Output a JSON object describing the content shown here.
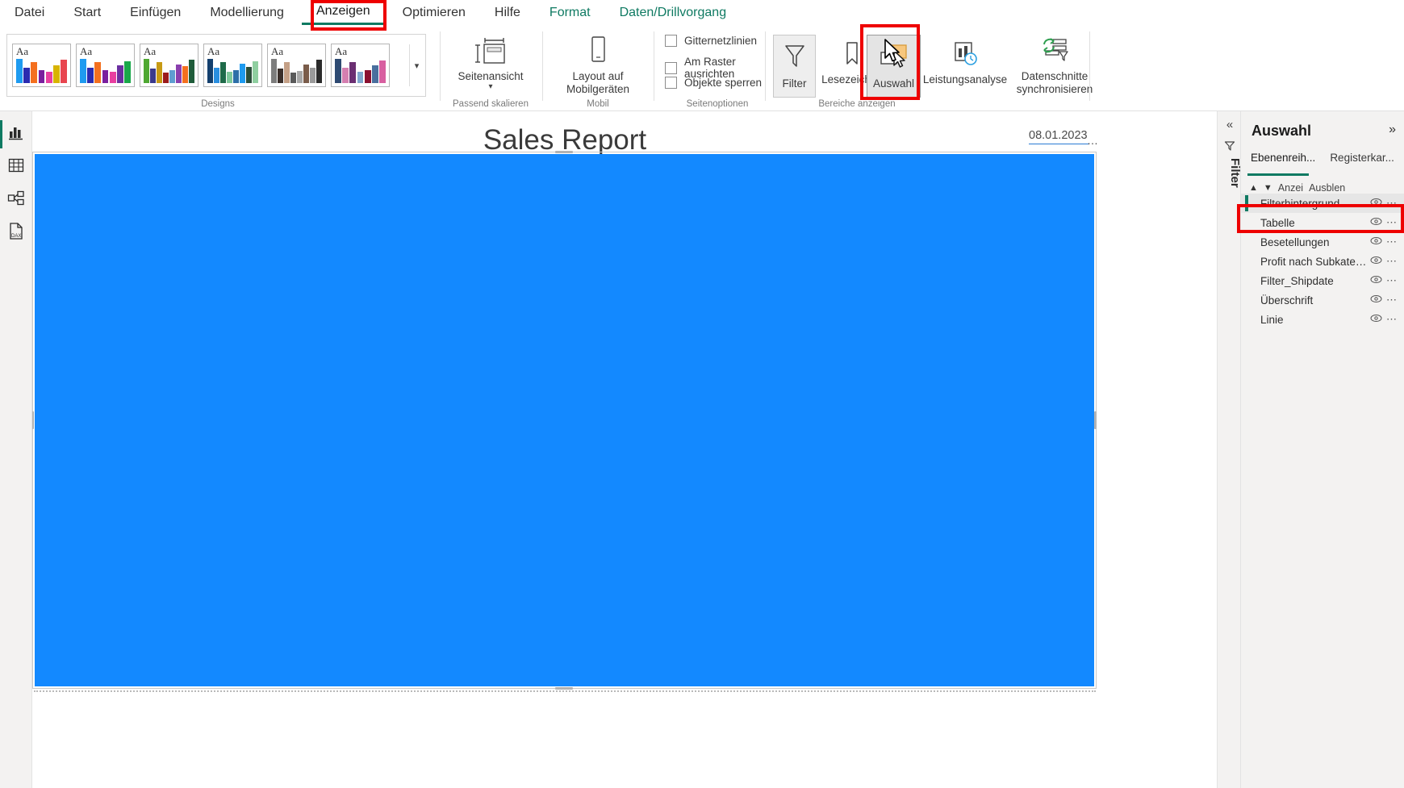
{
  "menu": {
    "items": [
      {
        "label": "Datei",
        "style": "normal"
      },
      {
        "label": "Start",
        "style": "normal"
      },
      {
        "label": "Einfügen",
        "style": "normal"
      },
      {
        "label": "Modellierung",
        "style": "normal"
      },
      {
        "label": "Anzeigen",
        "style": "active"
      },
      {
        "label": "Optimieren",
        "style": "normal"
      },
      {
        "label": "Hilfe",
        "style": "normal"
      },
      {
        "label": "Format",
        "style": "green"
      },
      {
        "label": "Daten/Drillvorgang",
        "style": "green"
      }
    ]
  },
  "ribbon": {
    "groups": {
      "designs_label": "Designs",
      "scale_label": "Passend skalieren",
      "mobile_label": "Mobil",
      "pageoptions_label": "Seitenoptionen",
      "panes_label": "Bereiche anzeigen"
    },
    "themes": [
      {
        "name": "theme-1",
        "colors": [
          "#1e9bf0",
          "#2b2bb0",
          "#f4701f",
          "#7a1f9e",
          "#e83fa0",
          "#d8b400",
          "#e8454f"
        ]
      },
      {
        "name": "theme-2",
        "colors": [
          "#1e9bf0",
          "#2b2bb0",
          "#f4701f",
          "#7a1f9e",
          "#e83fa0",
          "#6a2fa0",
          "#1aa84a"
        ]
      },
      {
        "name": "theme-3",
        "colors": [
          "#4fa832",
          "#3a3a8c",
          "#c79a14",
          "#9b1b1b",
          "#5f9ed1",
          "#8a3fae",
          "#f4701f",
          "#1f5c3a"
        ]
      },
      {
        "name": "theme-4",
        "colors": [
          "#14406e",
          "#2a8fe0",
          "#1f6b4a",
          "#7fc99b",
          "#2d6fa8",
          "#1e9bf0",
          "#2c4f3a",
          "#8fcfa0"
        ]
      },
      {
        "name": "theme-5",
        "colors": [
          "#7d7d7d",
          "#3a2e2a",
          "#c4a087",
          "#5a5a5a",
          "#a8a8a8",
          "#7a5c4a",
          "#9a9a9a",
          "#2b2b2b"
        ]
      },
      {
        "name": "theme-6",
        "colors": [
          "#2e4a72",
          "#d47fb0",
          "#6b2f72",
          "#7fa8cf",
          "#8a1030",
          "#4a6f9e",
          "#d85fa0"
        ]
      }
    ],
    "gallery_more_icon": "chevron-down-icon",
    "buttons": {
      "seitenansicht": {
        "label": "Seitenansicht",
        "icon": "page-view-icon",
        "has_caret": true
      },
      "mobile_layout": {
        "label": "Layout auf\nMobilgeräten",
        "line1": "Layout auf",
        "line2": "Mobilgeräten",
        "icon": "phone-icon"
      },
      "filter": {
        "label": "Filter",
        "icon": "funnel-icon"
      },
      "lesezeichen": {
        "label": "Lesezeichen",
        "icon": "bookmark-icon"
      },
      "auswahl": {
        "label": "Auswahl",
        "icon": "selection-pane-icon",
        "highlighted": true
      },
      "leistungsanalyse": {
        "label": "Leistungsanalyse",
        "icon": "performance-analyzer-icon"
      },
      "datenschnitte": {
        "line1": "Datenschnitte",
        "line2": "synchronisieren",
        "icon": "sync-slicers-icon"
      }
    },
    "checkboxes": [
      {
        "label": "Gitternetzlinien",
        "checked": false
      },
      {
        "label": "Am Raster ausrichten",
        "checked": false
      },
      {
        "label": "Objekte sperren",
        "checked": false
      }
    ]
  },
  "leftrail": {
    "items": [
      {
        "name": "report-view",
        "icon": "bar-chart-icon",
        "selected": true
      },
      {
        "name": "data-view",
        "icon": "table-icon",
        "selected": false
      },
      {
        "name": "model-view",
        "icon": "model-icon",
        "selected": false
      },
      {
        "name": "dax-query-view",
        "icon": "dax-query-icon",
        "selected": false
      }
    ]
  },
  "canvas": {
    "report_title": "Sales Report",
    "report_date": "08.01.2023",
    "date_overflow": "…",
    "shape_color": "#1389ff"
  },
  "filtertab": {
    "collapse_icon": "chevron-double-left-icon",
    "funnel_icon": "funnel-icon",
    "label": "Filter"
  },
  "selection_pane": {
    "title": "Auswahl",
    "expand_icon": "chevron-double-right-icon",
    "tabs": [
      {
        "label": "Ebenenreih...",
        "active": true
      },
      {
        "label": "Registerkar...",
        "active": false
      }
    ],
    "toolbar": {
      "up_icon": "arrow-up-icon",
      "down_icon": "arrow-down-icon",
      "show_label": "Anzei",
      "hide_label": "Ausblen"
    },
    "layers": [
      {
        "label": "Filterhintergrund",
        "selected": true,
        "visibility_icon": "eye-icon",
        "more_icon": "ellipsis-icon"
      },
      {
        "label": "Tabelle",
        "selected": false,
        "visibility_icon": "eye-icon",
        "more_icon": "ellipsis-icon"
      },
      {
        "label": "Besetellungen",
        "selected": false,
        "visibility_icon": "eye-icon",
        "more_icon": "ellipsis-icon"
      },
      {
        "label": "Profit nach Subkateg...",
        "selected": false,
        "visibility_icon": "eye-icon",
        "more_icon": "ellipsis-icon"
      },
      {
        "label": "Filter_Shipdate",
        "selected": false,
        "visibility_icon": "eye-icon",
        "more_icon": "ellipsis-icon"
      },
      {
        "label": "Überschrift",
        "selected": false,
        "visibility_icon": "eye-icon",
        "more_icon": "ellipsis-icon"
      },
      {
        "label": "Linie",
        "selected": false,
        "visibility_icon": "eye-icon",
        "more_icon": "ellipsis-icon"
      }
    ]
  },
  "annotations": {
    "highlight_color": "#ee0000",
    "accent_green": "#0f7a62"
  }
}
